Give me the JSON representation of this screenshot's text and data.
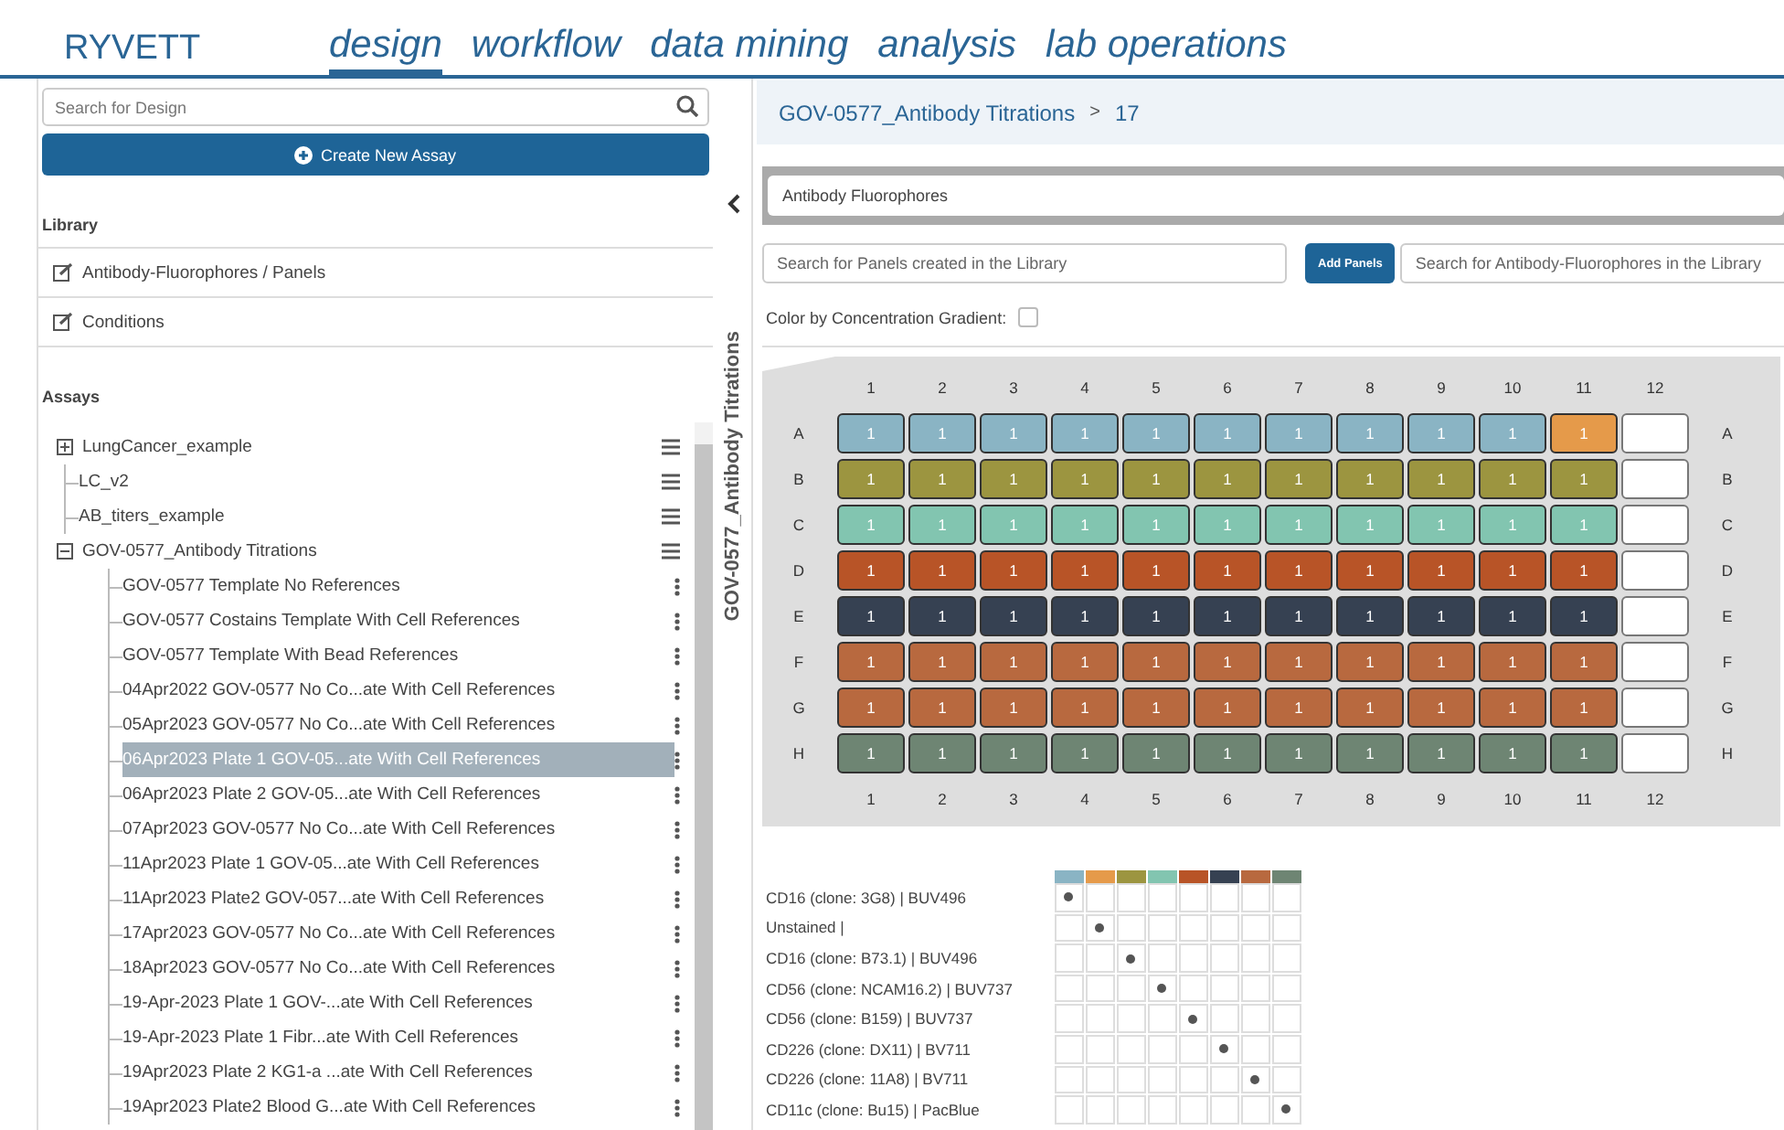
{
  "brand": "RYVETT",
  "nav": [
    {
      "label": "design",
      "selected": true
    },
    {
      "label": "workflow",
      "selected": false
    },
    {
      "label": "data mining",
      "selected": false
    },
    {
      "label": "analysis",
      "selected": false
    },
    {
      "label": "lab operations",
      "selected": false
    }
  ],
  "sidebar": {
    "search": {
      "placeholder": "Search for Design"
    },
    "create_button": "Create New Assay",
    "library_title": "Library",
    "library_items": [
      "Antibody-Fluorophores / Panels",
      "Conditions"
    ],
    "assays_title": "Assays",
    "assays": [
      {
        "label": "LungCancer_example",
        "kind": "folder",
        "expanded": false
      },
      {
        "label": "LC_v2",
        "kind": "item"
      },
      {
        "label": "AB_titers_example",
        "kind": "item"
      },
      {
        "label": "GOV-0577_Antibody Titrations",
        "kind": "folder",
        "expanded": true,
        "children": [
          {
            "label": "GOV-0577 Template No References",
            "selected": false
          },
          {
            "label": "GOV-0577 Costains Template With Cell References",
            "selected": false
          },
          {
            "label": "GOV-0577 Template With Bead References",
            "selected": false
          },
          {
            "label": "04Apr2022 GOV-0577 No Co...ate With Cell References",
            "selected": false
          },
          {
            "label": "05Apr2023 GOV-0577 No Co...ate With Cell References",
            "selected": false
          },
          {
            "label": "06Apr2023 Plate 1 GOV-05...ate With Cell References",
            "selected": true
          },
          {
            "label": "06Apr2023 Plate 2 GOV-05...ate With Cell References",
            "selected": false
          },
          {
            "label": "07Apr2023 GOV-0577 No Co...ate With Cell References",
            "selected": false
          },
          {
            "label": "11Apr2023 Plate 1 GOV-05...ate With Cell References",
            "selected": false
          },
          {
            "label": "11Apr2023 Plate2 GOV-057...ate With Cell References",
            "selected": false
          },
          {
            "label": "17Apr2023 GOV-0577 No Co...ate With Cell References",
            "selected": false
          },
          {
            "label": "18Apr2023 GOV-0577 No Co...ate With Cell References",
            "selected": false
          },
          {
            "label": "19-Apr-2023 Plate 1 GOV-...ate With Cell References",
            "selected": false
          },
          {
            "label": "19-Apr-2023 Plate 1 Fibr...ate With Cell References",
            "selected": false
          },
          {
            "label": "19Apr2023 Plate 2 KG1-a ...ate With Cell References",
            "selected": false
          },
          {
            "label": "19Apr2023 Plate2 Blood G...ate With Cell References",
            "selected": false
          }
        ]
      }
    ],
    "side_tab": "GOV-0577_Antibody Titrations"
  },
  "breadcrumb": {
    "parent": "GOV-0577_Antibody Titrations",
    "separator": ">",
    "current": "17"
  },
  "section_field": {
    "value": "Antibody Fluorophores"
  },
  "panel_search": {
    "placeholder": "Search for Panels created in the Library"
  },
  "add_button": "Add Panels",
  "fluor_search": {
    "placeholder": "Search for Antibody-Fluorophores in the Library"
  },
  "gradient": {
    "label": "Color by Concentration Gradient:",
    "checked": false
  },
  "plate": {
    "top_columns": [
      "1",
      "2",
      "3",
      "4",
      "5",
      "6",
      "7",
      "8",
      "9",
      "10",
      "11",
      "12"
    ],
    "bottom_columns": [
      "1",
      "2",
      "3",
      "4",
      "5",
      "6",
      "7",
      "8",
      "9",
      "10",
      "11",
      "12"
    ],
    "rows": [
      {
        "label": "A",
        "label_right": "A",
        "wells": [
          {
            "kind": "sample",
            "value": "1",
            "color": "#8ab4c4"
          },
          {
            "kind": "sample",
            "value": "1",
            "color": "#8ab4c4"
          },
          {
            "kind": "sample",
            "value": "1",
            "color": "#8ab4c4"
          },
          {
            "kind": "sample",
            "value": "1",
            "color": "#8ab4c4"
          },
          {
            "kind": "sample",
            "value": "1",
            "color": "#8ab4c4"
          },
          {
            "kind": "sample",
            "value": "1",
            "color": "#8ab4c4"
          },
          {
            "kind": "sample",
            "value": "1",
            "color": "#8ab4c4"
          },
          {
            "kind": "sample",
            "value": "1",
            "color": "#8ab4c4"
          },
          {
            "kind": "sample",
            "value": "1",
            "color": "#8ab4c4"
          },
          {
            "kind": "sample",
            "value": "1",
            "color": "#8ab4c4"
          },
          {
            "kind": "sample",
            "value": "1",
            "color": "#e59a4a"
          },
          {
            "kind": "empty"
          }
        ]
      },
      {
        "label": "B",
        "label_right": "B",
        "wells": [
          {
            "kind": "sample",
            "value": "1",
            "color": "#9c9540"
          },
          {
            "kind": "sample",
            "value": "1",
            "color": "#9c9540"
          },
          {
            "kind": "sample",
            "value": "1",
            "color": "#9c9540"
          },
          {
            "kind": "sample",
            "value": "1",
            "color": "#9c9540"
          },
          {
            "kind": "sample",
            "value": "1",
            "color": "#9c9540"
          },
          {
            "kind": "sample",
            "value": "1",
            "color": "#9c9540"
          },
          {
            "kind": "sample",
            "value": "1",
            "color": "#9c9540"
          },
          {
            "kind": "sample",
            "value": "1",
            "color": "#9c9540"
          },
          {
            "kind": "sample",
            "value": "1",
            "color": "#9c9540"
          },
          {
            "kind": "sample",
            "value": "1",
            "color": "#9c9540"
          },
          {
            "kind": "sample",
            "value": "1",
            "color": "#9c9540"
          },
          {
            "kind": "empty"
          }
        ]
      },
      {
        "label": "C",
        "label_right": "C",
        "wells": [
          {
            "kind": "sample",
            "value": "1",
            "color": "#82c5b0"
          },
          {
            "kind": "sample",
            "value": "1",
            "color": "#82c5b0"
          },
          {
            "kind": "sample",
            "value": "1",
            "color": "#82c5b0"
          },
          {
            "kind": "sample",
            "value": "1",
            "color": "#82c5b0"
          },
          {
            "kind": "sample",
            "value": "1",
            "color": "#82c5b0"
          },
          {
            "kind": "sample",
            "value": "1",
            "color": "#82c5b0"
          },
          {
            "kind": "sample",
            "value": "1",
            "color": "#82c5b0"
          },
          {
            "kind": "sample",
            "value": "1",
            "color": "#82c5b0"
          },
          {
            "kind": "sample",
            "value": "1",
            "color": "#82c5b0"
          },
          {
            "kind": "sample",
            "value": "1",
            "color": "#82c5b0"
          },
          {
            "kind": "sample",
            "value": "1",
            "color": "#82c5b0"
          },
          {
            "kind": "empty"
          }
        ]
      },
      {
        "label": "D",
        "label_right": "D",
        "wells": [
          {
            "kind": "sample",
            "value": "1",
            "color": "#b85427"
          },
          {
            "kind": "sample",
            "value": "1",
            "color": "#b85427"
          },
          {
            "kind": "sample",
            "value": "1",
            "color": "#b85427"
          },
          {
            "kind": "sample",
            "value": "1",
            "color": "#b85427"
          },
          {
            "kind": "sample",
            "value": "1",
            "color": "#b85427"
          },
          {
            "kind": "sample",
            "value": "1",
            "color": "#b85427"
          },
          {
            "kind": "sample",
            "value": "1",
            "color": "#b85427"
          },
          {
            "kind": "sample",
            "value": "1",
            "color": "#b85427"
          },
          {
            "kind": "sample",
            "value": "1",
            "color": "#b85427"
          },
          {
            "kind": "sample",
            "value": "1",
            "color": "#b85427"
          },
          {
            "kind": "sample",
            "value": "1",
            "color": "#b85427"
          },
          {
            "kind": "empty"
          }
        ]
      },
      {
        "label": "E",
        "label_right": "E",
        "wells": [
          {
            "kind": "sample",
            "value": "1",
            "color": "#364152"
          },
          {
            "kind": "sample",
            "value": "1",
            "color": "#364152"
          },
          {
            "kind": "sample",
            "value": "1",
            "color": "#364152"
          },
          {
            "kind": "sample",
            "value": "1",
            "color": "#364152"
          },
          {
            "kind": "sample",
            "value": "1",
            "color": "#364152"
          },
          {
            "kind": "sample",
            "value": "1",
            "color": "#364152"
          },
          {
            "kind": "sample",
            "value": "1",
            "color": "#364152"
          },
          {
            "kind": "sample",
            "value": "1",
            "color": "#364152"
          },
          {
            "kind": "sample",
            "value": "1",
            "color": "#364152"
          },
          {
            "kind": "sample",
            "value": "1",
            "color": "#364152"
          },
          {
            "kind": "sample",
            "value": "1",
            "color": "#364152"
          },
          {
            "kind": "empty"
          }
        ]
      },
      {
        "label": "F",
        "label_right": "F",
        "wells": [
          {
            "kind": "sample",
            "value": "1",
            "color": "#b8693f"
          },
          {
            "kind": "sample",
            "value": "1",
            "color": "#b8693f"
          },
          {
            "kind": "sample",
            "value": "1",
            "color": "#b8693f"
          },
          {
            "kind": "sample",
            "value": "1",
            "color": "#b8693f"
          },
          {
            "kind": "sample",
            "value": "1",
            "color": "#b8693f"
          },
          {
            "kind": "sample",
            "value": "1",
            "color": "#b8693f"
          },
          {
            "kind": "sample",
            "value": "1",
            "color": "#b8693f"
          },
          {
            "kind": "sample",
            "value": "1",
            "color": "#b8693f"
          },
          {
            "kind": "sample",
            "value": "1",
            "color": "#b8693f"
          },
          {
            "kind": "sample",
            "value": "1",
            "color": "#b8693f"
          },
          {
            "kind": "sample",
            "value": "1",
            "color": "#b8693f"
          },
          {
            "kind": "empty"
          }
        ]
      },
      {
        "label": "G",
        "label_right": "G",
        "wells": [
          {
            "kind": "sample",
            "value": "1",
            "color": "#b8693f"
          },
          {
            "kind": "sample",
            "value": "1",
            "color": "#b8693f"
          },
          {
            "kind": "sample",
            "value": "1",
            "color": "#b8693f"
          },
          {
            "kind": "sample",
            "value": "1",
            "color": "#b8693f"
          },
          {
            "kind": "sample",
            "value": "1",
            "color": "#b8693f"
          },
          {
            "kind": "sample",
            "value": "1",
            "color": "#b8693f"
          },
          {
            "kind": "sample",
            "value": "1",
            "color": "#b8693f"
          },
          {
            "kind": "sample",
            "value": "1",
            "color": "#b8693f"
          },
          {
            "kind": "sample",
            "value": "1",
            "color": "#b8693f"
          },
          {
            "kind": "sample",
            "value": "1",
            "color": "#b8693f"
          },
          {
            "kind": "sample",
            "value": "1",
            "color": "#b8693f"
          },
          {
            "kind": "empty"
          }
        ]
      },
      {
        "label": "H",
        "label_right": "H",
        "wells": [
          {
            "kind": "sample",
            "value": "1",
            "color": "#6e8573"
          },
          {
            "kind": "sample",
            "value": "1",
            "color": "#6e8573"
          },
          {
            "kind": "sample",
            "value": "1",
            "color": "#6e8573"
          },
          {
            "kind": "sample",
            "value": "1",
            "color": "#6e8573"
          },
          {
            "kind": "sample",
            "value": "1",
            "color": "#6e8573"
          },
          {
            "kind": "sample",
            "value": "1",
            "color": "#6e8573"
          },
          {
            "kind": "sample",
            "value": "1",
            "color": "#6e8573"
          },
          {
            "kind": "sample",
            "value": "1",
            "color": "#6e8573"
          },
          {
            "kind": "sample",
            "value": "1",
            "color": "#6e8573"
          },
          {
            "kind": "sample",
            "value": "1",
            "color": "#6e8573"
          },
          {
            "kind": "sample",
            "value": "1",
            "color": "#6e8573"
          },
          {
            "kind": "empty"
          }
        ]
      }
    ]
  },
  "legend": {
    "swatches": [
      {
        "color": "#8ab4c4"
      },
      {
        "color": "#e59a4a"
      },
      {
        "color": "#9c9540"
      },
      {
        "color": "#82c5b0"
      },
      {
        "color": "#b85427"
      },
      {
        "color": "#364152"
      },
      {
        "color": "#b8693f"
      },
      {
        "color": "#6e8573"
      }
    ],
    "rows": [
      {
        "label": "CD16 (clone: 3G8) | BUV496",
        "cells": [
          {
            "checked": true
          },
          {
            "checked": false
          },
          {
            "checked": false
          },
          {
            "checked": false
          },
          {
            "checked": false
          },
          {
            "checked": false
          },
          {
            "checked": false
          },
          {
            "checked": false
          }
        ]
      },
      {
        "label": "Unstained |",
        "cells": [
          {
            "checked": false
          },
          {
            "checked": true
          },
          {
            "checked": false
          },
          {
            "checked": false
          },
          {
            "checked": false
          },
          {
            "checked": false
          },
          {
            "checked": false
          },
          {
            "checked": false
          }
        ]
      },
      {
        "label": "CD16 (clone: B73.1) | BUV496",
        "cells": [
          {
            "checked": false
          },
          {
            "checked": false
          },
          {
            "checked": true
          },
          {
            "checked": false
          },
          {
            "checked": false
          },
          {
            "checked": false
          },
          {
            "checked": false
          },
          {
            "checked": false
          }
        ]
      },
      {
        "label": "CD56 (clone: NCAM16.2) | BUV737",
        "cells": [
          {
            "checked": false
          },
          {
            "checked": false
          },
          {
            "checked": false
          },
          {
            "checked": true
          },
          {
            "checked": false
          },
          {
            "checked": false
          },
          {
            "checked": false
          },
          {
            "checked": false
          }
        ]
      },
      {
        "label": "CD56 (clone: B159) | BUV737",
        "cells": [
          {
            "checked": false
          },
          {
            "checked": false
          },
          {
            "checked": false
          },
          {
            "checked": false
          },
          {
            "checked": true
          },
          {
            "checked": false
          },
          {
            "checked": false
          },
          {
            "checked": false
          }
        ]
      },
      {
        "label": "CD226 (clone: DX11) | BV711",
        "cells": [
          {
            "checked": false
          },
          {
            "checked": false
          },
          {
            "checked": false
          },
          {
            "checked": false
          },
          {
            "checked": false
          },
          {
            "checked": true
          },
          {
            "checked": false
          },
          {
            "checked": false
          }
        ]
      },
      {
        "label": "CD226 (clone: 11A8) | BV711",
        "cells": [
          {
            "checked": false
          },
          {
            "checked": false
          },
          {
            "checked": false
          },
          {
            "checked": false
          },
          {
            "checked": false
          },
          {
            "checked": false
          },
          {
            "checked": true
          },
          {
            "checked": false
          }
        ]
      },
      {
        "label": "CD11c (clone: Bu15) | PacBlue",
        "cells": [
          {
            "checked": false
          },
          {
            "checked": false
          },
          {
            "checked": false
          },
          {
            "checked": false
          },
          {
            "checked": false
          },
          {
            "checked": false
          },
          {
            "checked": false
          },
          {
            "checked": true
          }
        ]
      }
    ]
  }
}
